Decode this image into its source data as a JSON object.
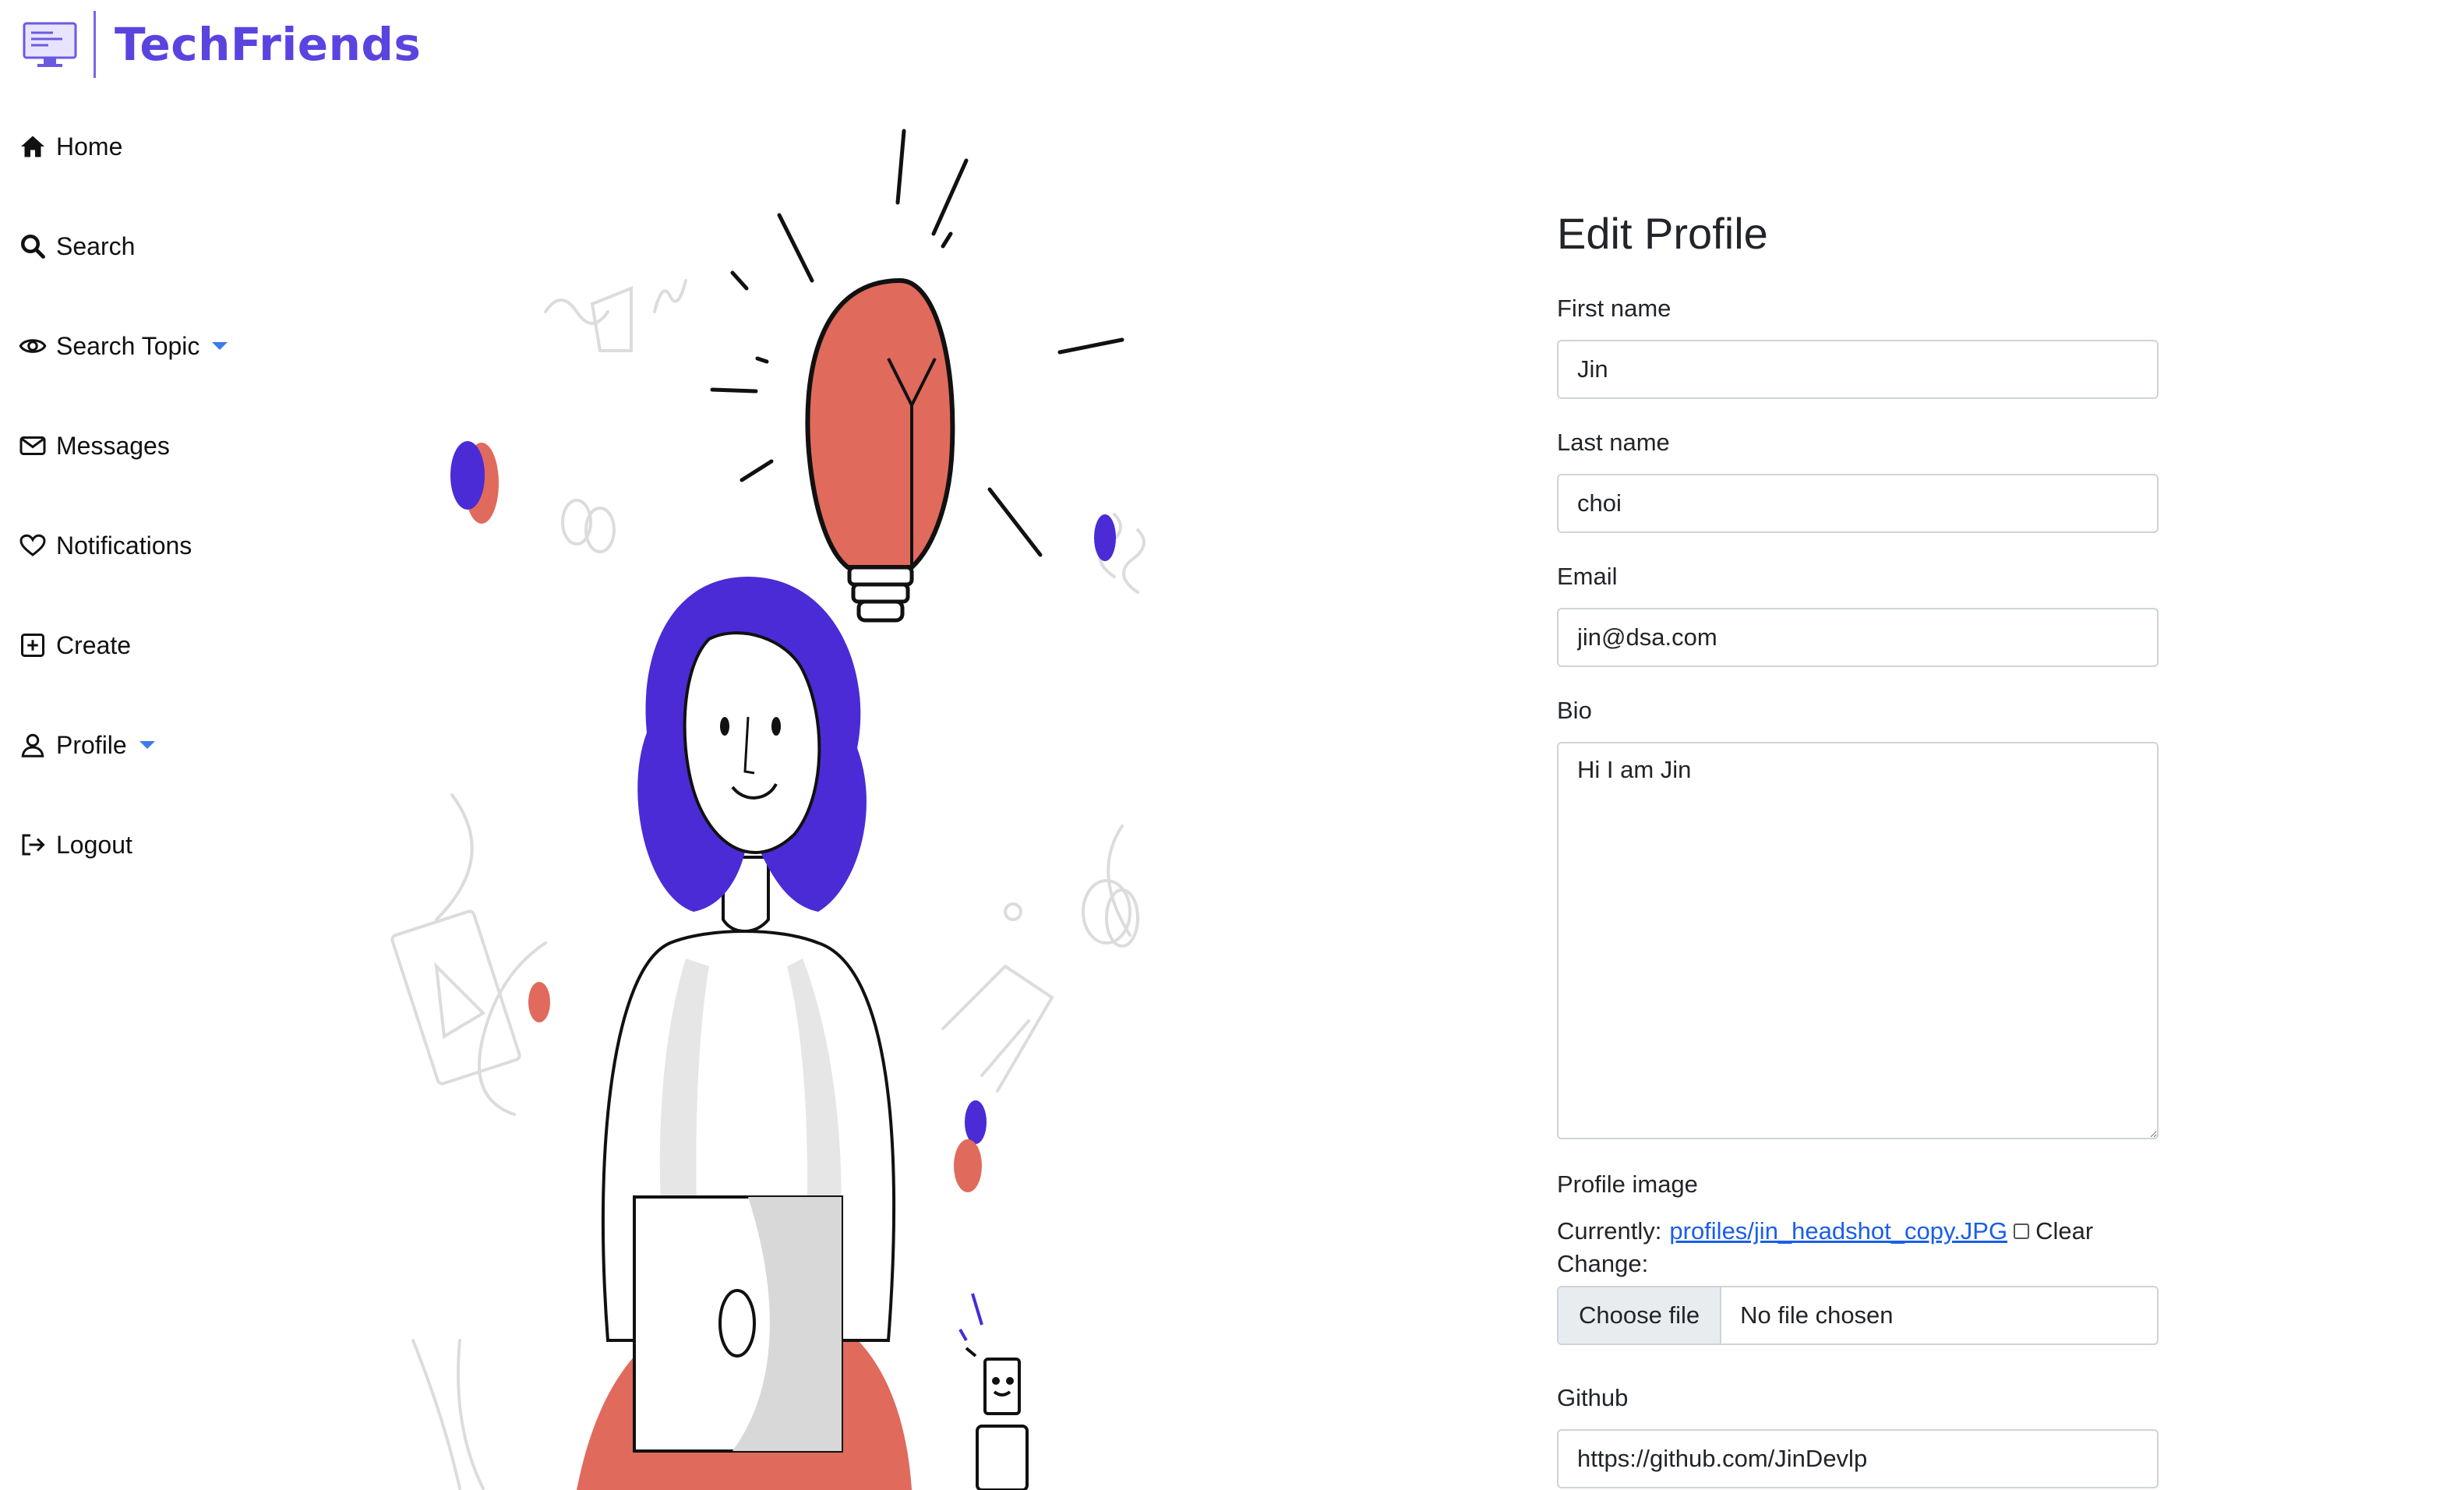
{
  "brand": {
    "name": "TechFriends",
    "logo_icon": "computer-monitor-icon",
    "accent": "#5a44e0"
  },
  "sidebar": {
    "items": [
      {
        "label": "Home",
        "icon": "home-icon"
      },
      {
        "label": "Search",
        "icon": "search-icon"
      },
      {
        "label": "Search Topic",
        "icon": "eye-icon",
        "dropdown": true
      },
      {
        "label": "Messages",
        "icon": "envelope-icon"
      },
      {
        "label": "Notifications",
        "icon": "heart-icon"
      },
      {
        "label": "Create",
        "icon": "plus-square-icon"
      },
      {
        "label": "Profile",
        "icon": "person-icon",
        "dropdown": true
      },
      {
        "label": "Logout",
        "icon": "logout-icon"
      }
    ],
    "caret_color": "#3c7be8"
  },
  "form": {
    "title": "Edit Profile",
    "first_name": {
      "label": "First name",
      "value": "Jin"
    },
    "last_name": {
      "label": "Last name",
      "value": "choi"
    },
    "email": {
      "label": "Email",
      "value": "jin@dsa.com"
    },
    "bio": {
      "label": "Bio",
      "value": "Hi I am Jin"
    },
    "profile_image": {
      "label": "Profile image",
      "currently_label": "Currently:",
      "current_file": "profiles/jin_headshot_copy.JPG",
      "clear_label": "Clear",
      "change_label": "Change:",
      "choose_button": "Choose file",
      "file_status": "No file chosen"
    },
    "github": {
      "label": "Github",
      "value": "https://github.com/JinDevlp"
    }
  },
  "illustration": {
    "subject": "woman-with-laptop-and-lightbulb",
    "colors": {
      "purple": "#4b2bd6",
      "coral": "#e06a5c",
      "gray": "#d9d9d9"
    }
  }
}
